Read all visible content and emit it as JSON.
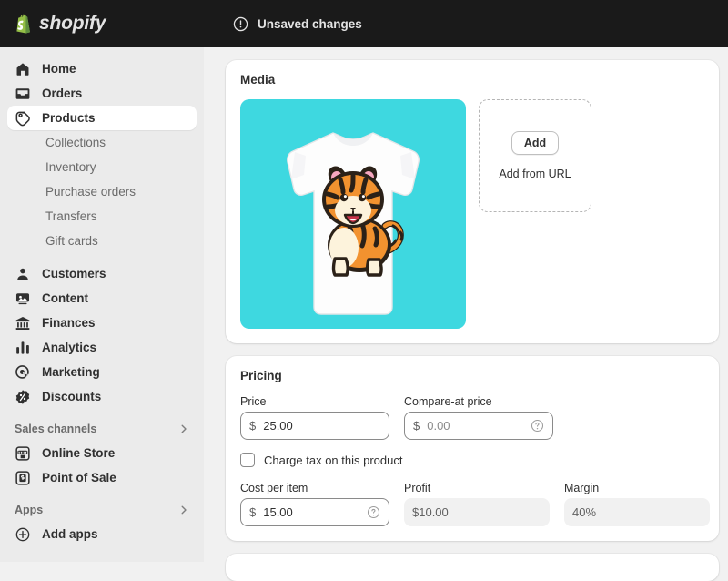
{
  "topbar": {
    "brand_name": "shopify",
    "brand_icon": "shopify-bag-icon",
    "unsaved_icon": "alert-circle-icon",
    "unsaved_label": "Unsaved changes",
    "background": "#1a1a1a"
  },
  "sidebar": {
    "background": "#ebebeb",
    "items": [
      {
        "label": "Home",
        "icon": "home-icon",
        "type": "nav",
        "active": false
      },
      {
        "label": "Orders",
        "icon": "orders-inbox-icon",
        "type": "nav",
        "active": false
      },
      {
        "label": "Products",
        "icon": "products-tag-icon",
        "type": "nav",
        "active": true
      },
      {
        "label": "Collections",
        "icon": "none",
        "type": "sub",
        "active": false
      },
      {
        "label": "Inventory",
        "icon": "none",
        "type": "sub",
        "active": false
      },
      {
        "label": "Purchase orders",
        "icon": "none",
        "type": "sub",
        "active": false
      },
      {
        "label": "Transfers",
        "icon": "none",
        "type": "sub",
        "active": false
      },
      {
        "label": "Gift cards",
        "icon": "none",
        "type": "sub",
        "active": false
      },
      {
        "label": "Customers",
        "icon": "customers-person-icon",
        "type": "nav",
        "active": false
      },
      {
        "label": "Content",
        "icon": "content-media-icon",
        "type": "nav",
        "active": false
      },
      {
        "label": "Finances",
        "icon": "finances-bank-icon",
        "type": "nav",
        "active": false
      },
      {
        "label": "Analytics",
        "icon": "analytics-bars-icon",
        "type": "nav",
        "active": false
      },
      {
        "label": "Marketing",
        "icon": "marketing-target-icon",
        "type": "nav",
        "active": false
      },
      {
        "label": "Discounts",
        "icon": "discounts-badge-icon",
        "type": "nav",
        "active": false
      }
    ],
    "sections": [
      {
        "title": "Sales channels",
        "chevron_icon": "chevron-right-icon",
        "items": [
          {
            "label": "Online Store",
            "icon": "online-store-icon"
          },
          {
            "label": "Point of Sale",
            "icon": "point-of-sale-icon"
          }
        ]
      },
      {
        "title": "Apps",
        "chevron_icon": "chevron-right-icon",
        "items": [
          {
            "label": "Add apps",
            "icon": "add-circle-icon"
          }
        ]
      }
    ]
  },
  "main": {
    "media": {
      "title": "Media",
      "thumbnail": {
        "alt": "White t-shirt with cartoon tiger cub graphic",
        "background_color": "#3ed8e0"
      },
      "dropzone": {
        "add_button_label": "Add",
        "add_from_url_label": "Add from URL"
      }
    },
    "pricing": {
      "title": "Pricing",
      "price": {
        "label": "Price",
        "currency": "$",
        "value": "25.00",
        "readonly": false,
        "has_help": false
      },
      "compare_at_price": {
        "label": "Compare-at price",
        "currency": "$",
        "value": "0.00",
        "is_placeholder": true,
        "readonly": false,
        "has_help": true,
        "help_icon": "help-circle-icon"
      },
      "charge_tax": {
        "label": "Charge tax on this product",
        "checked": false
      },
      "cost_per_item": {
        "label": "Cost per item",
        "currency": "$",
        "value": "15.00",
        "readonly": false,
        "has_help": true,
        "help_icon": "help-circle-icon"
      },
      "profit": {
        "label": "Profit",
        "value": "$10.00",
        "readonly": true
      },
      "margin": {
        "label": "Margin",
        "value": "40%",
        "readonly": true
      }
    }
  }
}
